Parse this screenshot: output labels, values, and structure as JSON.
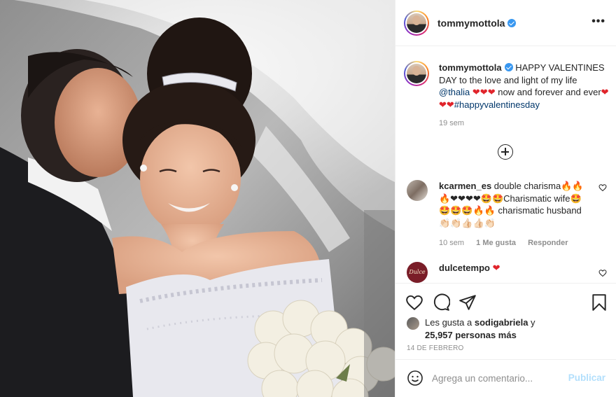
{
  "post": {
    "author": "tommymottola",
    "image_alt": "Wedding photo: groom kissing bride's cheek"
  },
  "header": {
    "username": "tommymottola",
    "more_label": "•••"
  },
  "caption": {
    "username": "tommymottola",
    "text_1": "HAPPY VALENTINES DAY to the love and light of my life",
    "mention": "@thalia",
    "hearts_1": "❤❤❤",
    "text_2": "now and forever and ever",
    "hearts_2": "❤❤❤",
    "hashtag": "#happyvalentinesday",
    "time": "19 sem"
  },
  "comments": [
    {
      "username": "kcarmen_es",
      "text": "double charisma🔥🔥🔥❤❤❤❤🤩🤩Charismatic wife🤩🤩🤩🤩🔥🔥 charismatic husband👏🏻👏🏻👍🏻👍🏻👏🏻",
      "time": "10 sem",
      "likes": "1 Me gusta",
      "reply": "Responder"
    },
    {
      "username": "dulcetempo",
      "text": "❤",
      "avatar_text": "Dulce"
    }
  ],
  "likes": {
    "line_1": "Les gusta a",
    "user": "sodigabriela",
    "line_2": "y",
    "count": "25,957 personas más"
  },
  "date": "14 DE FEBRERO",
  "add_comment": {
    "placeholder": "Agrega un comentario...",
    "publish_label": "Publicar"
  },
  "colors": {
    "verified": "#3897f0",
    "heart": "#e0242b",
    "link": "#00376b",
    "publish_disabled": "#b2dffc"
  }
}
